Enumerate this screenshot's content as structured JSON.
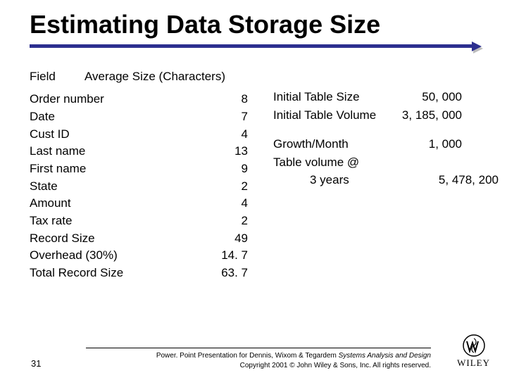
{
  "title": "Estimating Data Storage Size",
  "left": {
    "header1": "Field",
    "header2": "Average Size (Characters)",
    "rows": [
      {
        "label": "Order number",
        "value": "8"
      },
      {
        "label": "Date",
        "value": "7"
      },
      {
        "label": "Cust ID",
        "value": "4"
      },
      {
        "label": "Last name",
        "value": "13"
      },
      {
        "label": "First name",
        "value": "9"
      },
      {
        "label": "State",
        "value": "2"
      },
      {
        "label": "Amount",
        "value": "4"
      },
      {
        "label": "Tax rate",
        "value": "2"
      },
      {
        "label": "Record Size",
        "value": "49"
      },
      {
        "label": "Overhead (30%)",
        "value": "14. 7"
      },
      {
        "label": "Total Record Size",
        "value": "63. 7"
      }
    ]
  },
  "right": {
    "rows": [
      {
        "label": "Initial Table Size",
        "value": "50, 000",
        "indent": false,
        "gap": false
      },
      {
        "label": "Initial Table Volume",
        "value": "3, 185, 000",
        "indent": false,
        "gap": true
      },
      {
        "label": "Growth/Month",
        "value": "1, 000",
        "indent": false,
        "gap": false
      },
      {
        "label": "Table volume @",
        "value": "",
        "indent": false,
        "gap": false
      },
      {
        "label": "3 years",
        "value": "5, 478, 200",
        "indent": true,
        "gap": false
      }
    ]
  },
  "footer": {
    "line1a": "Power. Point Presentation for Dennis, Wixom & Tegardem ",
    "line1b": "Systems Analysis and Design",
    "line2": "Copyright 2001 © John Wiley & Sons, Inc. All rights reserved.",
    "page": "31",
    "brand": "WILEY"
  }
}
